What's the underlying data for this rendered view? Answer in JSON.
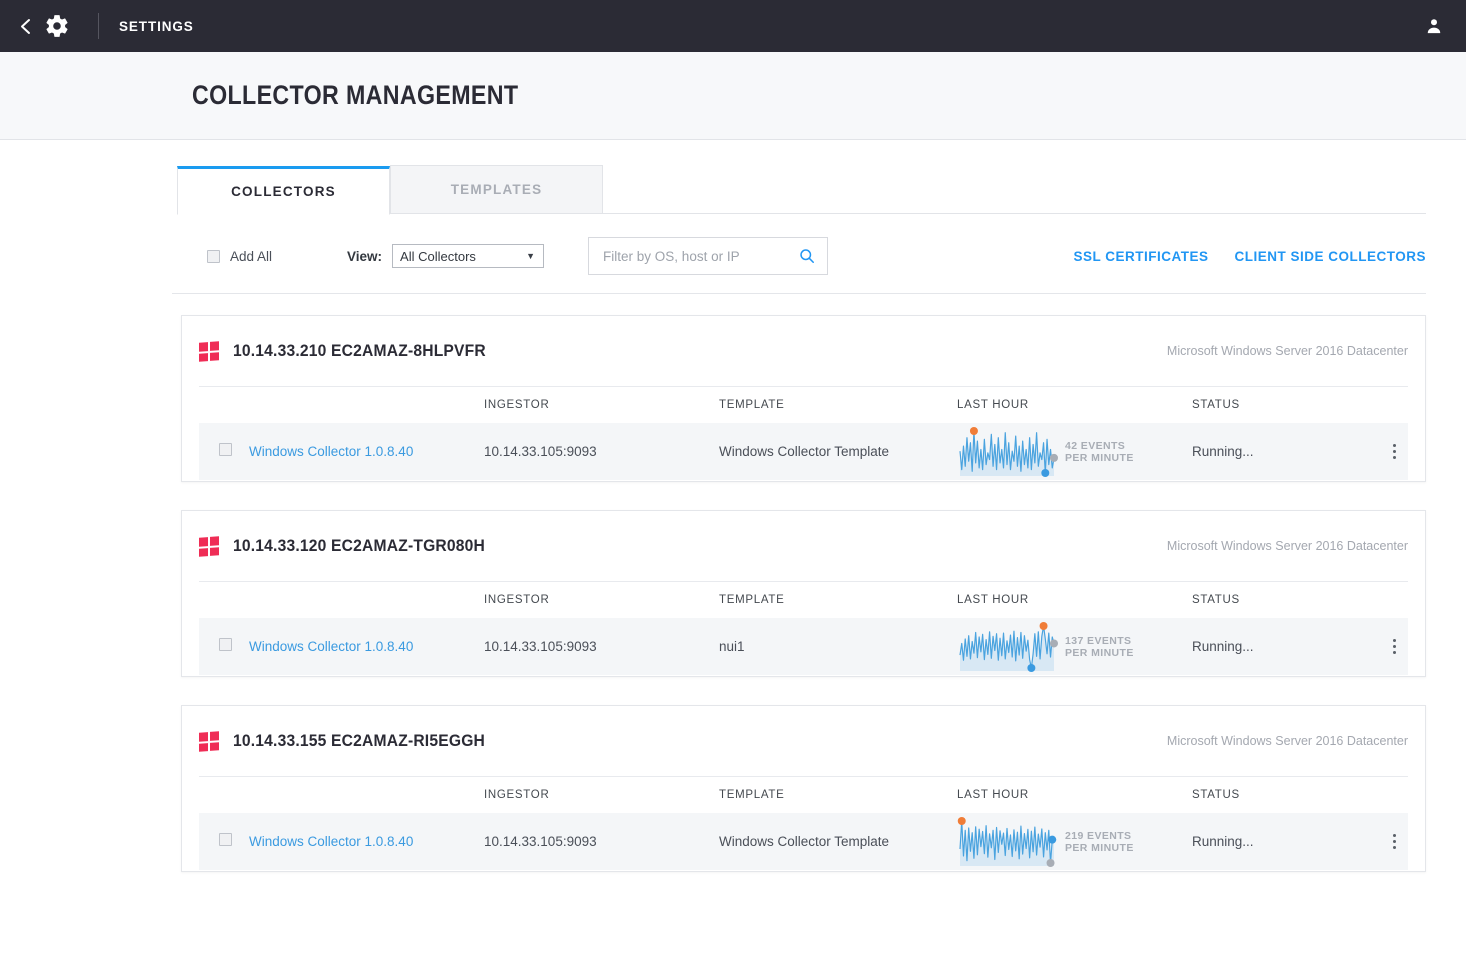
{
  "topbar": {
    "back_icon": "chevron-left-icon",
    "gear_icon": "gear-icon",
    "title": "SETTINGS",
    "user_icon": "user-avatar-icon"
  },
  "page": {
    "title": "COLLECTOR MANAGEMENT"
  },
  "tabs": [
    {
      "label": "COLLECTORS",
      "active": true
    },
    {
      "label": "TEMPLATES",
      "active": false
    }
  ],
  "toolbar": {
    "add_all_label": "Add All",
    "view_label": "View:",
    "view_selected": "All Collectors",
    "view_caret": "▼",
    "search_placeholder": "Filter by OS, host or IP",
    "search_value": "",
    "search_icon": "search-icon",
    "links": [
      {
        "label": "SSL CERTIFICATES"
      },
      {
        "label": "CLIENT SIDE COLLECTORS"
      }
    ]
  },
  "columns": {
    "ingestor": "INGESTOR",
    "template": "TEMPLATE",
    "last_hour": "LAST HOUR",
    "status": "STATUS"
  },
  "accent": {
    "blue": "#2196f3",
    "link_blue": "#3a9ae0",
    "windows_red": "#ef2d56",
    "spark_line": "#4aa3df",
    "spark_max_dot": "#f07d38",
    "spark_min_dot": "#3a9ae0",
    "spark_last_dot": "#a8adb5",
    "topbar_bg": "#2b2b35"
  },
  "collectors": [
    {
      "os_icon": "windows-logo-icon",
      "host": "10.14.33.210 EC2AMAZ-8HLPVFR",
      "os": "Microsoft Windows Server 2016 Datacenter",
      "rows": [
        {
          "name": "Windows Collector 1.0.8.40",
          "ingestor": "10.14.33.105:9093",
          "template": "Windows Collector Template",
          "events_value": "42 EVENTS",
          "events_unit": "PER MINUTE",
          "status": "Running...",
          "menu_icon": "kebab-menu-icon"
        }
      ]
    },
    {
      "os_icon": "windows-logo-icon",
      "host": "10.14.33.120 EC2AMAZ-TGR080H",
      "os": "Microsoft Windows Server 2016 Datacenter",
      "rows": [
        {
          "name": "Windows Collector 1.0.8.40",
          "ingestor": "10.14.33.105:9093",
          "template": "nui1",
          "events_value": "137 EVENTS",
          "events_unit": "PER MINUTE",
          "status": "Running...",
          "menu_icon": "kebab-menu-icon"
        }
      ]
    },
    {
      "os_icon": "windows-logo-icon",
      "host": "10.14.33.155 EC2AMAZ-RI5EGGH",
      "os": "Microsoft Windows Server 2016 Datacenter",
      "rows": [
        {
          "name": "Windows Collector 1.0.8.40",
          "ingestor": "10.14.33.105:9093",
          "template": "Windows Collector Template",
          "events_value": "219 EVENTS",
          "events_unit": "PER MINUTE",
          "status": "Running...",
          "menu_icon": "kebab-menu-icon"
        }
      ]
    }
  ],
  "chart_data": [
    {
      "type": "line",
      "title": "Last Hour — 10.14.33.210 EC2AMAZ-8HLPVFR",
      "ylabel": "Events per minute",
      "summary_value": 42,
      "summary_unit": "EVENTS PER MINUTE",
      "markers": {
        "max_index": 8,
        "min_index": 49,
        "last_index": 54
      },
      "values": [
        28,
        6,
        34,
        10,
        44,
        16,
        38,
        4,
        52,
        14,
        40,
        8,
        30,
        6,
        42,
        12,
        26,
        18,
        48,
        10,
        36,
        6,
        44,
        14,
        30,
        8,
        50,
        12,
        38,
        6,
        28,
        16,
        46,
        10,
        34,
        4,
        40,
        12,
        30,
        8,
        44,
        6,
        36,
        14,
        50,
        10,
        26,
        18,
        38,
        2,
        42,
        12,
        30,
        8,
        20
      ]
    },
    {
      "type": "line",
      "title": "Last Hour — 10.14.33.120 EC2AMAZ-TGR080H",
      "ylabel": "Events per minute",
      "summary_value": 137,
      "summary_unit": "EVENTS PER MINUTE",
      "markers": {
        "max_index": 48,
        "min_index": 41,
        "last_index": 54
      },
      "values": [
        60,
        96,
        44,
        110,
        56,
        120,
        48,
        102,
        66,
        130,
        52,
        116,
        70,
        124,
        46,
        108,
        62,
        132,
        50,
        118,
        74,
        126,
        44,
        112,
        58,
        128,
        48,
        104,
        68,
        122,
        54,
        134,
        42,
        114,
        60,
        130,
        50,
        120,
        72,
        106,
        46,
        20,
        64,
        126,
        56,
        132,
        48,
        118,
        150,
        110,
        64,
        128,
        54,
        116,
        96
      ]
    },
    {
      "type": "line",
      "title": "Last Hour — 10.14.33.155 EC2AMAZ-RI5EGGH",
      "ylabel": "Events per minute",
      "summary_value": 219,
      "summary_unit": "EVENTS PER MINUTE",
      "markers": {
        "max_index": 1,
        "min_index": 53,
        "last_index": 52
      },
      "values": [
        120,
        240,
        90,
        200,
        70,
        210,
        110,
        190,
        80,
        215,
        95,
        205,
        130,
        195,
        100,
        220,
        85,
        185,
        125,
        200,
        75,
        212,
        105,
        198,
        140,
        188,
        92,
        208,
        118,
        180,
        88,
        202,
        112,
        192,
        78,
        218,
        98,
        186,
        122,
        204,
        82,
        196,
        108,
        214,
        94,
        184,
        128,
        206,
        86,
        190,
        116,
        200,
        60,
        160,
        150
      ]
    }
  ]
}
